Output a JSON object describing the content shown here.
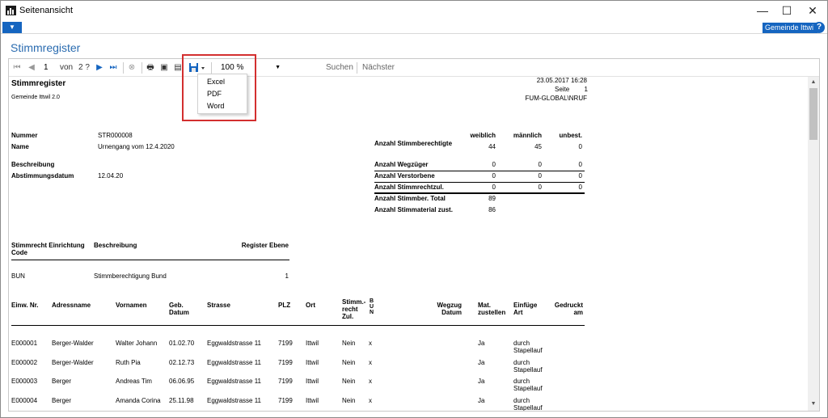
{
  "window": {
    "title": "Seitenansicht",
    "minimize": "—",
    "maximize": "☐",
    "close": "✕"
  },
  "nav": {
    "dropdown_arrow": "▼",
    "gemeinde": "Gemeinde Ittwil",
    "help": "?"
  },
  "page_title": "Stimmregister",
  "toolbar": {
    "page": "1",
    "of_label": "von",
    "total_pages": "2 ?",
    "zoom": "100 %",
    "search_label": "Suchen",
    "next_label": "Nächster"
  },
  "export_menu": [
    "Excel",
    "PDF",
    "Word"
  ],
  "report": {
    "title": "Stimmregister",
    "subtitle": "Gemeinde Ittwil 2.0",
    "datetime": "23.05.2017 16:28",
    "page_label": "Seite",
    "page_no": "1",
    "user": "FUM-GLOBAL\\NRUF",
    "fields": [
      {
        "label": "Nummer",
        "value": "STR000008"
      },
      {
        "label": "Name",
        "value": "Urnengang vom 12.4.2020"
      },
      {
        "label": "Beschreibung",
        "value": ""
      },
      {
        "label": "Abstimmungsdatum",
        "value": "12.04.20"
      }
    ],
    "stats_headers": [
      "weiblich",
      "männlich",
      "unbest."
    ],
    "stats": [
      {
        "label": "Anzahl Stimmberechtigte",
        "values": [
          "44",
          "45",
          "0"
        ]
      },
      {
        "label": "Anzahl Wegzüger",
        "values": [
          "0",
          "0",
          "0"
        ]
      },
      {
        "label": "Anzahl Verstorbene",
        "values": [
          "0",
          "0",
          "0"
        ]
      },
      {
        "label": "Anzahl Stimmrechtzul.",
        "values": [
          "0",
          "0",
          "0"
        ]
      },
      {
        "label": "Anzahl Stimmber. Total",
        "values": [
          "89"
        ]
      },
      {
        "label": "Anzahl Stimmaterial zust.",
        "values": [
          "86"
        ]
      }
    ],
    "stimmrecht_headers": [
      "Stimmrecht Einrichtung Code",
      "Beschreibung",
      "Register Ebene"
    ],
    "stimmrecht_rows": [
      {
        "code": "BUN",
        "desc": "Stimmberechtigung Bund",
        "ebene": "1"
      }
    ],
    "person_headers": {
      "nr": "Einw. Nr.",
      "adress": "Adressname",
      "vorname": "Vornamen",
      "geb": "Geb. Datum",
      "strasse": "Strasse",
      "plz": "PLZ",
      "ort": "Ort",
      "zul": "Stimm.-recht Zul.",
      "bun": "BUN",
      "wegzug": "Wegzug Datum",
      "mat": "Mat. zustellen",
      "einfuege": "Einfüge Art",
      "gedruckt": "Gedruckt am"
    },
    "persons": [
      {
        "nr": "E000001",
        "adress": "Berger-Walder",
        "vorname": "Walter Johann",
        "geb": "01.02.70",
        "strasse": "Eggwaldstrasse 11",
        "plz": "7199",
        "ort": "Ittwil",
        "zul": "Nein",
        "bun": "x",
        "mat": "Ja",
        "art": "durch Stapellauf"
      },
      {
        "nr": "E000002",
        "adress": "Berger-Walder",
        "vorname": "Ruth Pia",
        "geb": "02.12.73",
        "strasse": "Eggwaldstrasse 11",
        "plz": "7199",
        "ort": "Ittwil",
        "zul": "Nein",
        "bun": "x",
        "mat": "Ja",
        "art": "durch Stapellauf"
      },
      {
        "nr": "E000003",
        "adress": "Berger",
        "vorname": "Andreas Tim",
        "geb": "06.06.95",
        "strasse": "Eggwaldstrasse 11",
        "plz": "7199",
        "ort": "Ittwil",
        "zul": "Nein",
        "bun": "x",
        "mat": "Ja",
        "art": "durch Stapellauf"
      },
      {
        "nr": "E000004",
        "adress": "Berger",
        "vorname": "Amanda Corina",
        "geb": "25.11.98",
        "strasse": "Eggwaldstrasse 11",
        "plz": "7199",
        "ort": "Ittwil",
        "zul": "Nein",
        "bun": "x",
        "mat": "Ja",
        "art": "durch Stapellauf"
      }
    ]
  },
  "colors": {
    "accent": "#1565c0",
    "heading": "#2b6cb0",
    "highlight": "#d32f2f"
  }
}
